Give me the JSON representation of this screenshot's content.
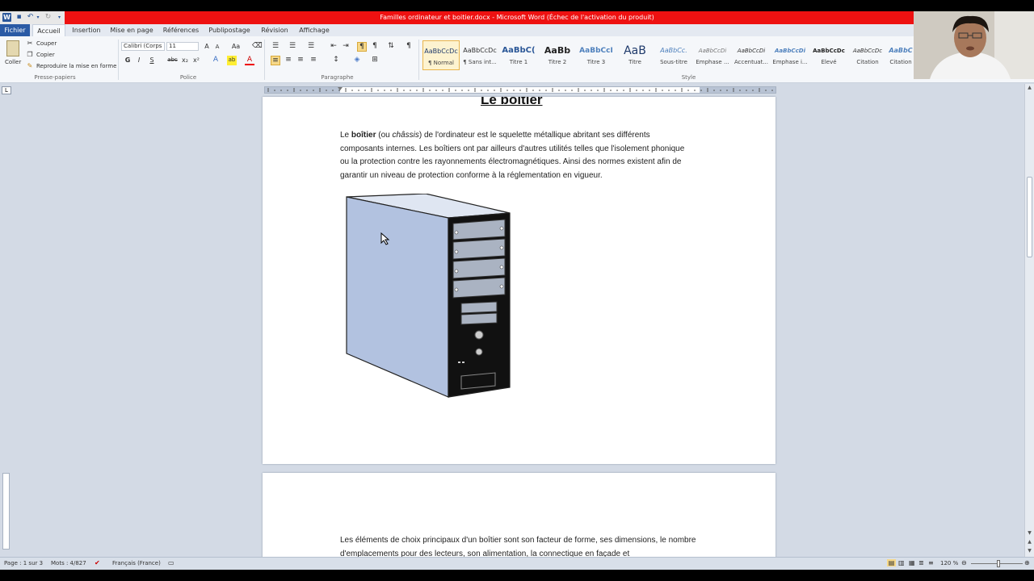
{
  "window": {
    "title": "Familles ordinateur et boitier.docx  -  Microsoft Word (Échec de l'activation du produit)"
  },
  "tabs": [
    {
      "label": "Fichier"
    },
    {
      "label": "Accueil"
    },
    {
      "label": "Insertion"
    },
    {
      "label": "Mise en page"
    },
    {
      "label": "Références"
    },
    {
      "label": "Publipostage"
    },
    {
      "label": "Révision"
    },
    {
      "label": "Affichage"
    }
  ],
  "clipboard": {
    "paste": "Coller",
    "cut": "Couper",
    "copy": "Copier",
    "format_painter": "Reproduire la mise en forme",
    "label": "Presse-papiers"
  },
  "font": {
    "name": "Calibri (Corps",
    "size": "11",
    "label": "Police",
    "bold": "G",
    "italic": "I",
    "underline": "S",
    "strike": "abc",
    "case": "Aa"
  },
  "paragraph": {
    "label": "Paragraphe"
  },
  "styles": {
    "label": "Style",
    "items": [
      {
        "sample": "AaBbCcDc",
        "name": "¶ Normal"
      },
      {
        "sample": "AaBbCcDc",
        "name": "¶ Sans int..."
      },
      {
        "sample": "AaBbC(",
        "name": "Titre 1"
      },
      {
        "sample": "AaBb",
        "name": "Titre 2"
      },
      {
        "sample": "AaBbCcI",
        "name": "Titre 3"
      },
      {
        "sample": "AaB",
        "name": "Titre"
      },
      {
        "sample": "AaBbCc.",
        "name": "Sous-titre"
      },
      {
        "sample": "AaBbCcDi",
        "name": "Emphase ..."
      },
      {
        "sample": "AaBbCcDi",
        "name": "Accentuat..."
      },
      {
        "sample": "AaBbCcDi",
        "name": "Emphase i..."
      },
      {
        "sample": "AaBbCcDc",
        "name": "Élevé"
      },
      {
        "sample": "AaBbCcDc",
        "name": "Citation"
      },
      {
        "sample": "AaBbC",
        "name": "Citation"
      }
    ]
  },
  "document": {
    "heading": "Le boitier",
    "para1": {
      "t1": "Le ",
      "b1": "boîtier",
      "t2": " (ou ",
      "i1": "châssis",
      "t3": ") de l'ordinateur est le squelette métallique abritant ses différents composants internes. Les boîtiers ont par ailleurs d'autres utilités telles que l'isolement phonique ou la protection contre les rayonnements électromagnétiques. Ainsi des normes existent afin de garantir un niveau de protection conforme à la réglementation en vigueur."
    },
    "para2": "Les éléments de choix principaux d'un boîtier sont son facteur de forme, ses dimensions, le nombre d'emplacements pour des lecteurs, son alimentation, la connectique en façade et"
  },
  "status": {
    "page": "Page : 1 sur 3",
    "words": "Mots : 4/827",
    "language": "Français (France)",
    "zoom": "120 %"
  },
  "colors": {
    "title_bar": "#ee1111",
    "file_tab": "#2a5aa5",
    "tower_side": "#b2c2e0"
  }
}
